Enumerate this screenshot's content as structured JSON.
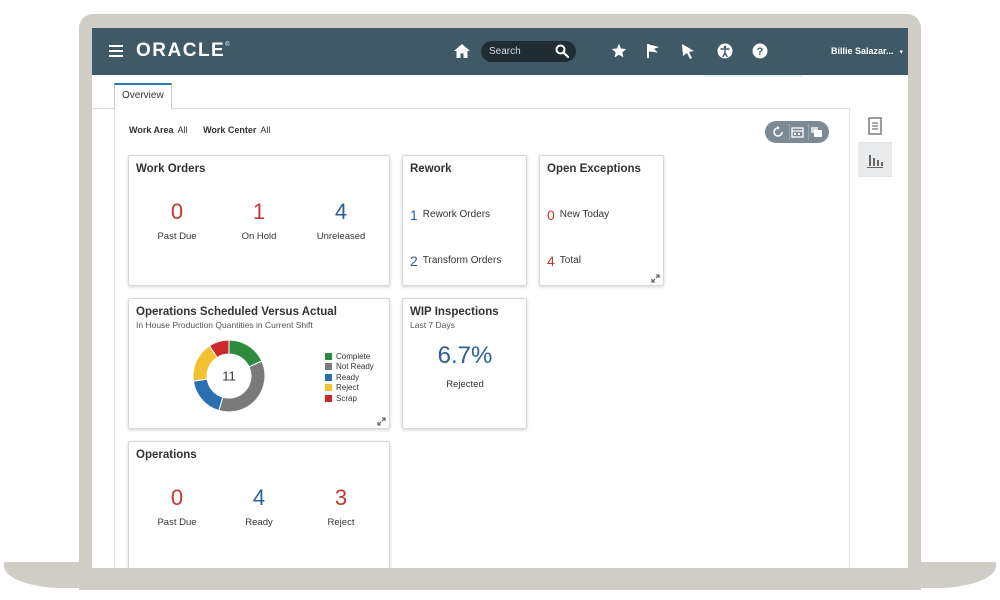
{
  "colors": {
    "topbar": "#3f5a66",
    "search_bg": "#1f2d33",
    "tab_accent": "#2f77b1",
    "metric_red": "#c7362f",
    "metric_blue": "#2b5f9a",
    "frame": "#cfcdc6"
  },
  "header": {
    "logo": "ORACLE",
    "logo_mark": "®",
    "search_placeholder": "Search",
    "user_name": "Billie Salazar...",
    "user_caret": "▾",
    "icons": [
      "menu-icon",
      "home-icon",
      "search-icon",
      "star-icon",
      "flag-icon",
      "pointer-icon",
      "accessibility-icon",
      "help-icon"
    ]
  },
  "tabs": [
    {
      "label": "Overview",
      "active": true
    }
  ],
  "filters": {
    "work_area_label": "Work Area",
    "work_area_value": "All",
    "work_center_label": "Work Center",
    "work_center_value": "All"
  },
  "actions": [
    "refresh-icon",
    "schedule-icon",
    "layers-icon"
  ],
  "cards": {
    "work_orders": {
      "title": "Work Orders",
      "metrics": [
        {
          "value": "0",
          "label": "Past Due",
          "color": "red"
        },
        {
          "value": "1",
          "label": "On Hold",
          "color": "red"
        },
        {
          "value": "4",
          "label": "Unreleased",
          "color": "blue"
        }
      ]
    },
    "rework": {
      "title": "Rework",
      "rows": [
        {
          "value": "1",
          "label": "Rework Orders"
        },
        {
          "value": "2",
          "label": "Transform Orders"
        }
      ]
    },
    "open_exceptions": {
      "title": "Open Exceptions",
      "rows": [
        {
          "value": "0",
          "label": "New Today"
        },
        {
          "value": "4",
          "label": "Total"
        }
      ]
    },
    "ops_scheduled": {
      "title": "Operations Scheduled Versus Actual",
      "subtitle": "In House Production Quantities in Current Shift",
      "total": "11",
      "legend": [
        {
          "label": "Complete",
          "color": "#2e8b3e"
        },
        {
          "label": "Not Ready",
          "color": "#7a7a7a"
        },
        {
          "label": "Ready",
          "color": "#2a6fb2"
        },
        {
          "label": "Reject",
          "color": "#f2c232"
        },
        {
          "label": "Scrap",
          "color": "#cc2a2a"
        }
      ]
    },
    "wip": {
      "title": "WIP Inspections",
      "subtitle": "Last 7 Days",
      "value": "6.7%",
      "label": "Rejected"
    },
    "operations": {
      "title": "Operations",
      "metrics": [
        {
          "value": "0",
          "label": "Past Due",
          "color": "red"
        },
        {
          "value": "4",
          "label": "Ready",
          "color": "blue"
        },
        {
          "value": "3",
          "label": "Reject",
          "color": "red"
        }
      ]
    }
  },
  "chart_data": {
    "type": "pie",
    "categories": [
      "Complete",
      "Not Ready",
      "Ready",
      "Reject",
      "Scrap"
    ],
    "values": [
      2,
      4,
      2,
      2,
      1
    ],
    "colors": [
      "#2e8b3e",
      "#7a7a7a",
      "#2a6fb2",
      "#f2c232",
      "#cc2a2a"
    ],
    "title": "Operations Scheduled Versus Actual",
    "subtitle": "In House Production Quantities in Current Shift",
    "center_label": "11",
    "legend_position": "right"
  },
  "rail": [
    "report-icon",
    "chart-icon"
  ]
}
